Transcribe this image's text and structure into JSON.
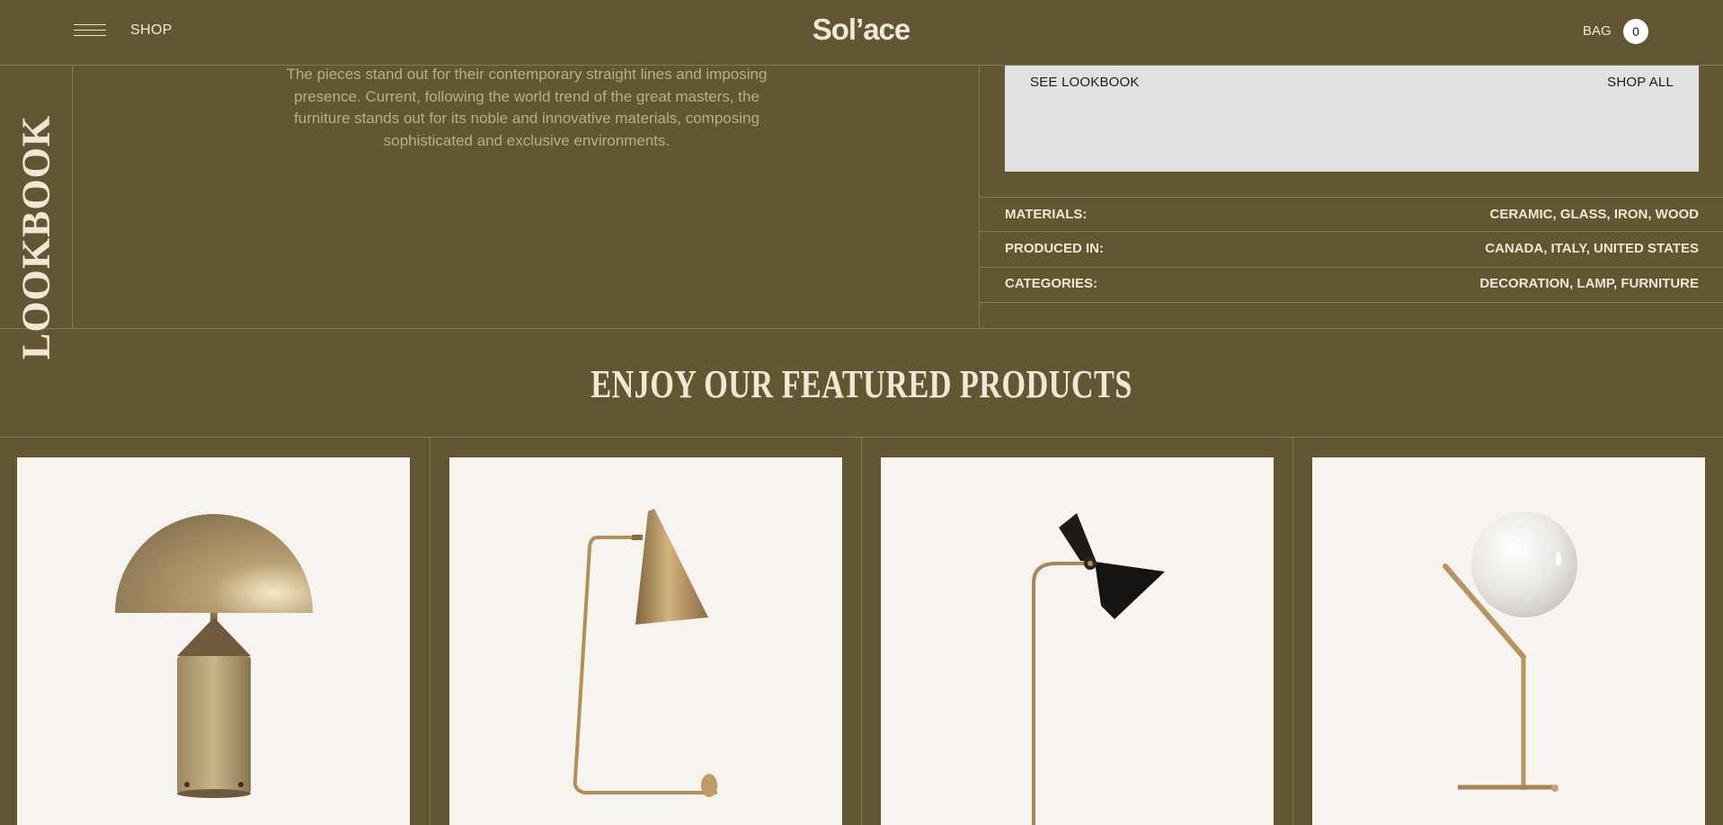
{
  "header": {
    "menu_icon": "hamburger-icon",
    "shop_label": "SHOP",
    "logo": "Sol’ace",
    "bag_label": "BAG",
    "bag_count": "0"
  },
  "lookbook": {
    "vertical_title": "LOOKBOOK",
    "description": "The pieces stand out for their contemporary straight lines and imposing presence. Current, following the world trend of the great masters, the furniture stands out for its noble and innovative materials, composing sophisticated and exclusive environments.",
    "see_lookbook": "SEE LOOKBOOK",
    "shop_all": "SHOP ALL",
    "details": [
      {
        "label": "MATERIALS:",
        "value": "CERAMIC, GLASS, IRON, WOOD"
      },
      {
        "label": "PRODUCED IN:",
        "value": "CANADA, ITALY, UNITED STATES"
      },
      {
        "label": "CATEGORIES:",
        "value": "DECORATION, LAMP, FURNITURE"
      }
    ]
  },
  "featured": {
    "title": "ENJOY OUR FEATURED PRODUCTS",
    "products": [
      {
        "icon": "dome-table-lamp-image"
      },
      {
        "icon": "cone-desk-lamp-image"
      },
      {
        "icon": "black-floor-lamp-image"
      },
      {
        "icon": "globe-table-lamp-image"
      }
    ]
  },
  "colors": {
    "background": "#625633",
    "text": "#ebe3cc",
    "card": "#f7f4ef",
    "lookbook_card": "#e1e1e3"
  }
}
